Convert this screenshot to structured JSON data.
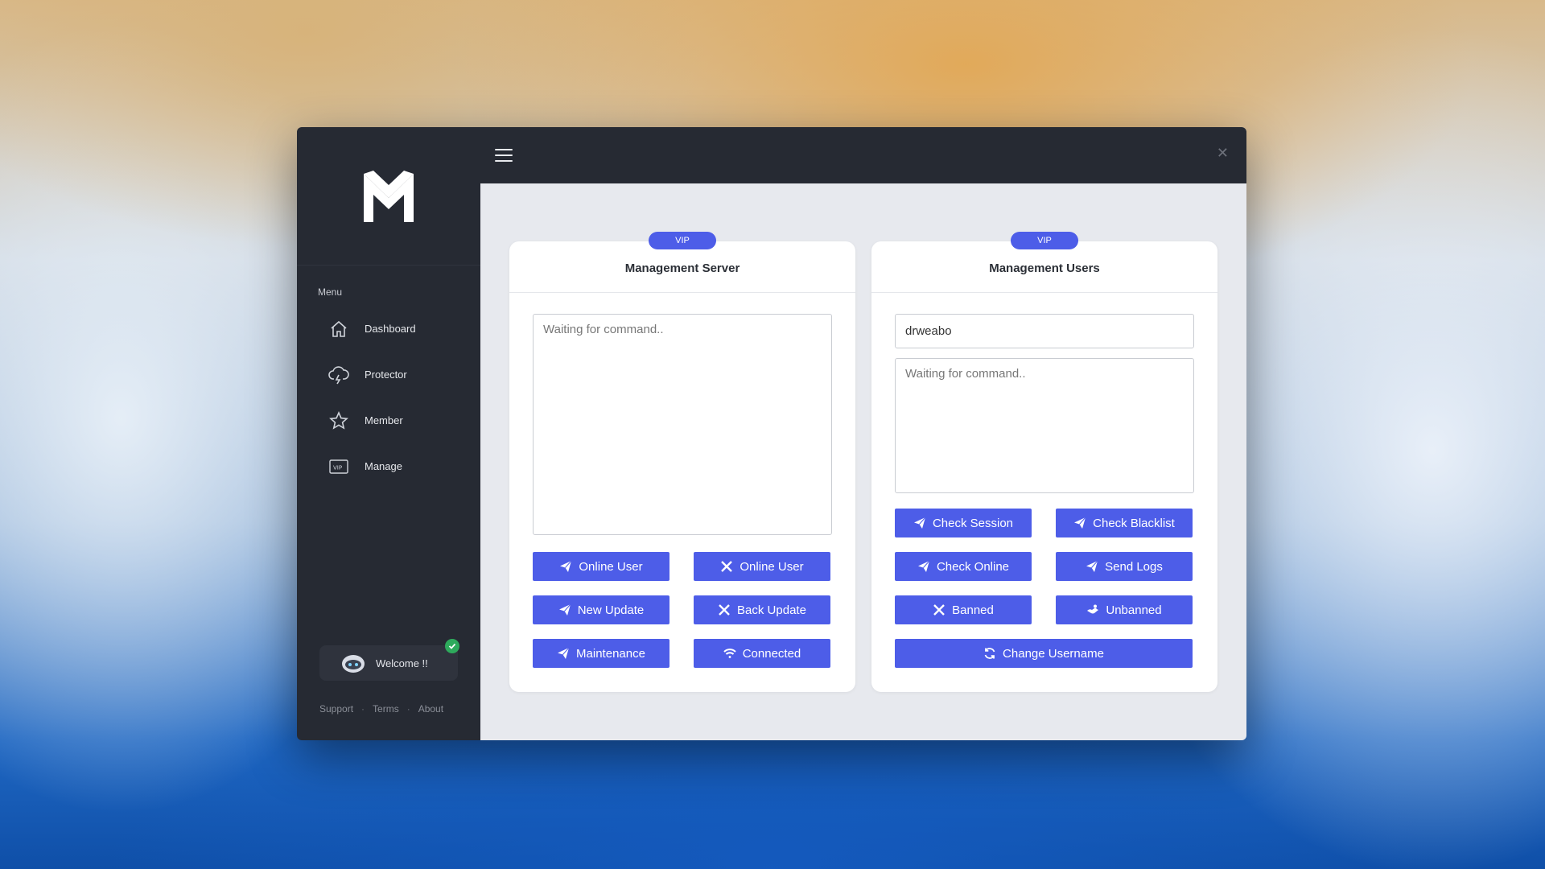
{
  "sidebar": {
    "menu_title": "Menu",
    "items": [
      {
        "label": "Dashboard",
        "icon": "home-icon"
      },
      {
        "label": "Protector",
        "icon": "cloud-lightning-icon"
      },
      {
        "label": "Member",
        "icon": "star-icon"
      },
      {
        "label": "Manage",
        "icon": "vip-card-icon"
      }
    ],
    "welcome": "Welcome !!",
    "footer": [
      "Support",
      "Terms",
      "About"
    ]
  },
  "colors": {
    "accent": "#4d5de8",
    "sidebar": "#262a33",
    "content_bg": "#e7e9ee",
    "verified": "#2eaa5c"
  },
  "server_card": {
    "badge": "VIP",
    "title": "Management Server",
    "placeholder": "Waiting for command..",
    "buttons": [
      {
        "label": "Online User",
        "icon": "send-icon"
      },
      {
        "label": "Online User",
        "icon": "x-icon"
      },
      {
        "label": "New Update",
        "icon": "send-icon"
      },
      {
        "label": "Back Update",
        "icon": "x-icon"
      },
      {
        "label": "Maintenance",
        "icon": "send-icon"
      },
      {
        "label": "Connected",
        "icon": "wifi-icon"
      }
    ]
  },
  "users_card": {
    "badge": "VIP",
    "title": "Management Users",
    "username_value": "drweabo",
    "placeholder": "Waiting for command..",
    "buttons": [
      {
        "label": "Check Session",
        "icon": "send-icon"
      },
      {
        "label": "Check Blacklist",
        "icon": "send-icon"
      },
      {
        "label": "Check Online",
        "icon": "send-icon"
      },
      {
        "label": "Send Logs",
        "icon": "send-icon"
      },
      {
        "label": "Banned",
        "icon": "x-icon"
      },
      {
        "label": "Unbanned",
        "icon": "handshake-icon"
      },
      {
        "label": "Change Username",
        "icon": "refresh-icon"
      }
    ]
  }
}
